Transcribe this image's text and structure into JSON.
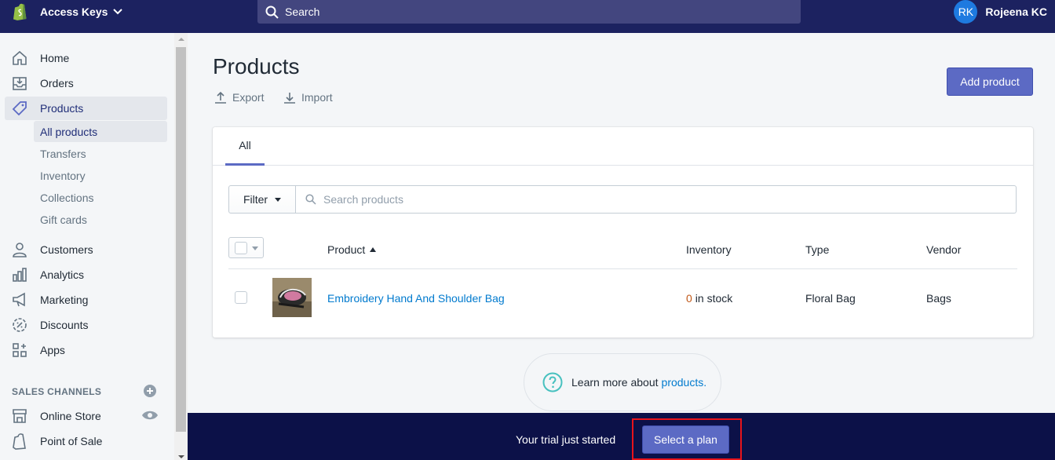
{
  "topbar": {
    "store_name": "Access Keys",
    "search_placeholder": "Search",
    "user_initials": "RK",
    "user_name": "Rojeena KC"
  },
  "sidebar": {
    "items": [
      {
        "label": "Home",
        "icon": "home-icon"
      },
      {
        "label": "Orders",
        "icon": "orders-icon"
      },
      {
        "label": "Products",
        "icon": "tag-icon",
        "active": true
      },
      {
        "label": "Customers",
        "icon": "person-icon"
      },
      {
        "label": "Analytics",
        "icon": "bar-chart-icon"
      },
      {
        "label": "Marketing",
        "icon": "megaphone-icon"
      },
      {
        "label": "Discounts",
        "icon": "discount-icon"
      },
      {
        "label": "Apps",
        "icon": "apps-icon"
      }
    ],
    "product_subitems": [
      "All products",
      "Transfers",
      "Inventory",
      "Collections",
      "Gift cards"
    ],
    "sales_channels_label": "SALES CHANNELS",
    "channels": [
      {
        "label": "Online Store",
        "icon": "store-icon"
      },
      {
        "label": "Point of Sale",
        "icon": "shopping-bag-icon"
      }
    ]
  },
  "main": {
    "title": "Products",
    "export_label": "Export",
    "import_label": "Import",
    "add_product_label": "Add product",
    "tabs": [
      {
        "label": "All"
      }
    ],
    "filter_label": "Filter",
    "search_placeholder": "Search products",
    "columns": {
      "product": "Product",
      "inventory": "Inventory",
      "type": "Type",
      "vendor": "Vendor"
    },
    "rows": [
      {
        "name": "Embroidery Hand And Shoulder Bag",
        "inventory_count": "0",
        "inventory_suffix": "in stock",
        "type": "Floral Bag",
        "vendor": "Bags"
      }
    ],
    "learn_more_text": "Learn more about",
    "learn_more_link": "products."
  },
  "trial_bar": {
    "text": "Your trial just started",
    "button_label": "Select a plan"
  },
  "colors": {
    "topbar": "#1c2260",
    "primary_button": "#5c6ac4",
    "link": "#007ace",
    "trial_bar": "#0c1148",
    "highlight": "#e8141b"
  }
}
